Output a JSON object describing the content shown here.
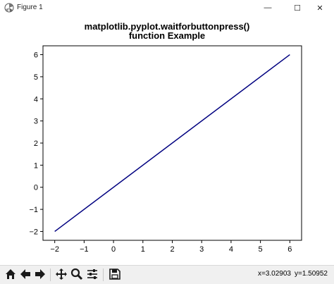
{
  "window": {
    "title": "Figure 1",
    "controls": [
      "—",
      "☐",
      "✕"
    ]
  },
  "figure": {
    "title_line1": "matplotlib.pyplot.waitforbuttonpress()",
    "title_line2": "function Example"
  },
  "chart_data": {
    "type": "line",
    "title": "matplotlib.pyplot.waitforbuttonpress() function Example",
    "xlabel": "",
    "ylabel": "",
    "x": [
      -2,
      6
    ],
    "series": [
      {
        "values": [
          -2,
          6
        ],
        "color": "#000080"
      }
    ],
    "xlim": [
      -2.4,
      6.4
    ],
    "ylim": [
      -2.4,
      6.4
    ],
    "xticks": [
      -2,
      -1,
      0,
      1,
      2,
      3,
      4,
      5,
      6
    ],
    "yticks": [
      -2,
      -1,
      0,
      1,
      2,
      3,
      4,
      5,
      6
    ],
    "xtick_labels": [
      "−2",
      "−1",
      "0",
      "1",
      "2",
      "3",
      "4",
      "5",
      "6"
    ],
    "ytick_labels": [
      "−2",
      "−1",
      "0",
      "1",
      "2",
      "3",
      "4",
      "5",
      "6"
    ],
    "grid": false
  },
  "toolbar": {
    "buttons": [
      "home-icon",
      "back-icon",
      "forward-icon",
      "pan-icon",
      "zoom-icon",
      "subplots-icon",
      "save-icon"
    ],
    "coord_x": "x=3.02903",
    "coord_y": "y=1.50952"
  }
}
